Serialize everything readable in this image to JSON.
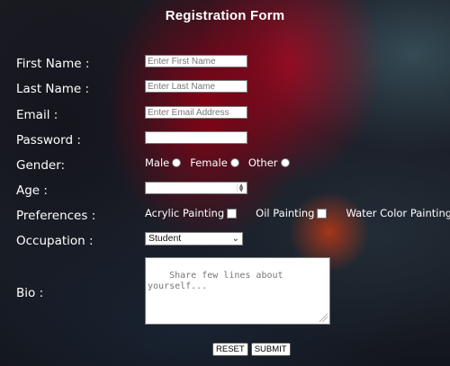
{
  "form": {
    "title": "Registration Form",
    "fields": {
      "first_name": {
        "label": "First Name :",
        "placeholder": "Enter First Name",
        "value": ""
      },
      "last_name": {
        "label": "Last Name :",
        "placeholder": "Enter Last Name",
        "value": ""
      },
      "email": {
        "label": "Email :",
        "placeholder": "Enter Email Address",
        "value": ""
      },
      "password": {
        "label": "Password :",
        "placeholder": "",
        "value": ""
      },
      "gender": {
        "label": "Gender:",
        "options": [
          "Male",
          "Female",
          "Other"
        ]
      },
      "age": {
        "label": "Age :",
        "value": ""
      },
      "preferences": {
        "label": "Preferences :",
        "options": [
          "Acrylic Painting",
          "Oil Painting",
          "Water Color Painting"
        ]
      },
      "occupation": {
        "label": "Occupation :",
        "selected": "Student"
      },
      "bio": {
        "label": "Bio :",
        "placeholder": "Share few lines about\nyourself..."
      }
    },
    "buttons": {
      "reset": "RESET",
      "submit": "SUBMIT"
    }
  }
}
